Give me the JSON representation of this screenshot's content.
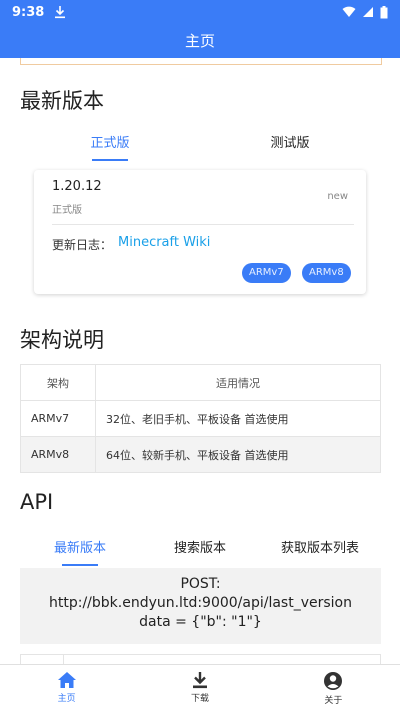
{
  "status_bar": {
    "time": "9:38"
  },
  "app_bar": {
    "title": "主页"
  },
  "latest": {
    "title": "最新版本",
    "tabs": [
      {
        "label": "正式版",
        "active": true
      },
      {
        "label": "测试版",
        "active": false
      }
    ],
    "card": {
      "version": "1.20.12",
      "channel": "正式版",
      "badge": "new",
      "changelog_label": "更新日志：",
      "changelog_link": "Minecraft Wiki",
      "chips": [
        "ARMv7",
        "ARMv8"
      ]
    }
  },
  "arch": {
    "title": "架构说明",
    "headers": [
      "架构",
      "适用情况"
    ],
    "rows": [
      [
        "ARMv7",
        "32位、老旧手机、平板设备 首选使用"
      ],
      [
        "ARMv8",
        "64位、较新手机、平板设备 首选使用"
      ]
    ]
  },
  "api": {
    "title": "API",
    "tabs": [
      {
        "label": "最新版本",
        "active": true
      },
      {
        "label": "搜索版本",
        "active": false
      },
      {
        "label": "获取版本列表",
        "active": false
      }
    ],
    "code_lines": [
      "POST:",
      "http://bbk.endyun.ltd:9000/api/last_version",
      "data = {\"b\": \"1\"}"
    ]
  },
  "bottom_nav": [
    {
      "label": "主页",
      "icon": "home-icon",
      "active": true
    },
    {
      "label": "下载",
      "icon": "download-icon",
      "active": false
    },
    {
      "label": "关于",
      "icon": "account-icon",
      "active": false
    }
  ],
  "colors": {
    "primary": "#3a7cf7",
    "link": "#1aa0e8"
  }
}
